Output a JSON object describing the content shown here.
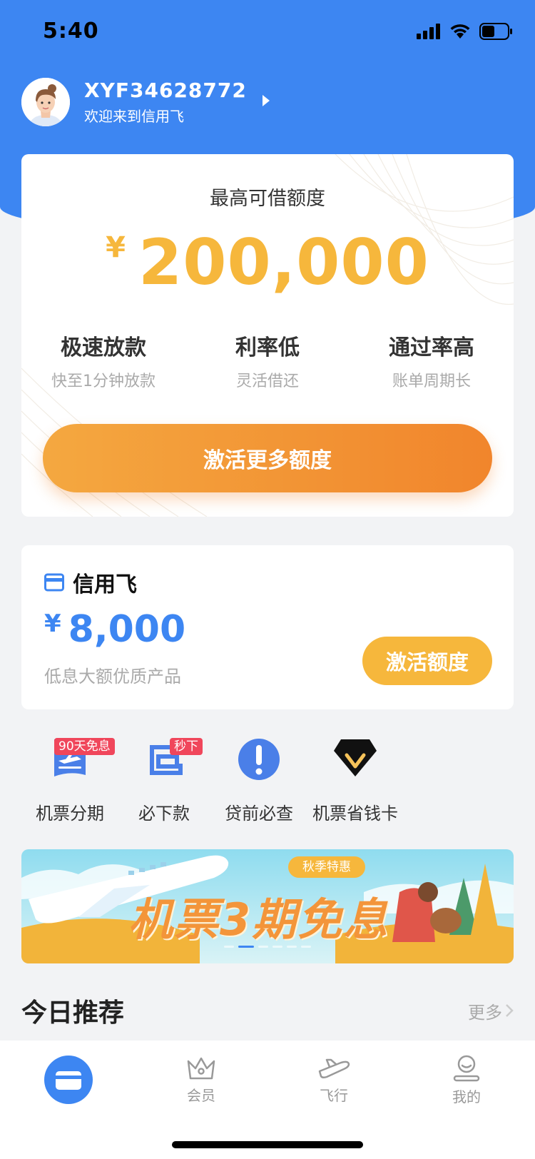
{
  "status_bar": {
    "time": "5:40"
  },
  "profile": {
    "username": "XYF34628772",
    "welcome": "欢迎来到信用飞"
  },
  "quota_card": {
    "title": "最高可借额度",
    "currency": "¥",
    "amount": "200,000",
    "features": [
      {
        "title": "极速放款",
        "desc": "快至1分钟放款"
      },
      {
        "title": "利率低",
        "desc": "灵活借还"
      },
      {
        "title": "通过率高",
        "desc": "账单周期长"
      }
    ],
    "button": "激活更多额度"
  },
  "product_card": {
    "name": "信用飞",
    "currency": "¥",
    "amount": "8,000",
    "desc": "低息大额优质产品",
    "button": "激活额度"
  },
  "quick_items": [
    {
      "label": "机票分期",
      "badge": "90天免息",
      "icon": "ticket-icon"
    },
    {
      "label": "必下款",
      "badge": "秒下",
      "icon": "loan-icon"
    },
    {
      "label": "贷前必查",
      "badge": "",
      "icon": "alert-icon"
    },
    {
      "label": "机票省钱卡",
      "badge": "",
      "icon": "diamond-card-icon"
    }
  ],
  "banner": {
    "tag": "秋季特惠",
    "text": "机票3期免息",
    "dots": 6,
    "active_dot": 1
  },
  "recommend": {
    "title": "今日推荐",
    "more": "更多"
  },
  "tabbar": {
    "items": [
      {
        "label": "",
        "icon": "card-icon",
        "active": true
      },
      {
        "label": "会员",
        "icon": "crown-icon"
      },
      {
        "label": "飞行",
        "icon": "plane-icon"
      },
      {
        "label": "我的",
        "icon": "user-icon"
      }
    ]
  },
  "colors": {
    "brand_blue": "#3d86f2",
    "accent_orange": "#f1852c",
    "accent_yellow": "#f6b73c",
    "badge_red": "#f0465b"
  }
}
